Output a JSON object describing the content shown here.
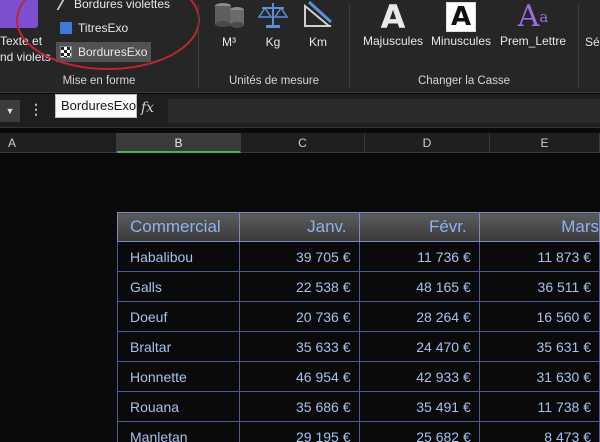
{
  "ribbon": {
    "mise_en_forme": {
      "label": "Mise en forme",
      "texte_line1": "Texte et",
      "texte_line2": "nd violets",
      "styles": [
        {
          "label": "Bordures violettes"
        },
        {
          "label": "TitresExo"
        },
        {
          "label": "BorduresExo"
        }
      ]
    },
    "unites": {
      "label": "Unités de mesure",
      "buttons": [
        {
          "label": "M³"
        },
        {
          "label": "Kg"
        },
        {
          "label": "Km"
        }
      ]
    },
    "casse": {
      "label": "Changer la Casse",
      "buttons": [
        {
          "label": "Majuscules",
          "glyph": "A"
        },
        {
          "label": "Minuscules",
          "glyph": "A"
        },
        {
          "label": "Prem_Lettre",
          "glyph": "A",
          "sup": "a"
        }
      ]
    },
    "last": {
      "label": "Sé"
    }
  },
  "formula_bar": {
    "tooltip": "BorduresExo",
    "fx": "fx"
  },
  "columns": [
    "A",
    "B",
    "C",
    "D",
    "E"
  ],
  "table": {
    "headers": [
      "Commercial",
      "Janv.",
      "Févr.",
      "Mars"
    ],
    "rows": [
      [
        "Habalibou",
        "39 705 €",
        "11 736 €",
        "11 873 €"
      ],
      [
        "Galls",
        "22 538 €",
        "48 165 €",
        "36 511 €"
      ],
      [
        "Doeuf",
        "20 736 €",
        "28 264 €",
        "16 560 €"
      ],
      [
        "Braltar",
        "35 633 €",
        "24 470 €",
        "35 631 €"
      ],
      [
        "Honnette",
        "46 954 €",
        "42 933 €",
        "31 630 €"
      ],
      [
        "Rouana",
        "35 686 €",
        "35 491 €",
        "11 738 €"
      ],
      [
        "Manletan",
        "29 195 €",
        "25 682 €",
        "8 473 €"
      ]
    ]
  },
  "colors": {
    "accent_purple": "#7b4fd0",
    "oval_red": "#c0262e",
    "table_text": "#a8c2ee",
    "table_border": "#4a5a9a"
  }
}
